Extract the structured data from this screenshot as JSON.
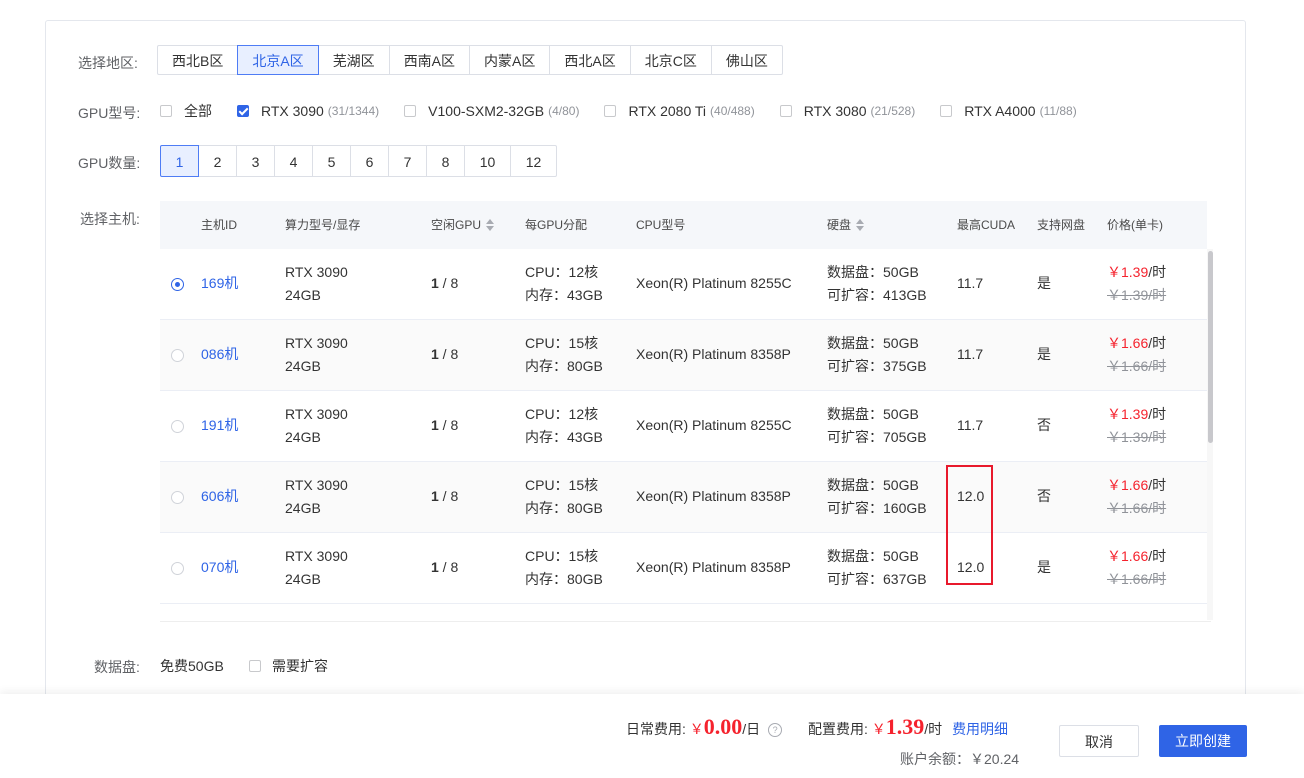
{
  "form": {
    "region_label": "选择地区:",
    "gpu_model_label": "GPU型号:",
    "gpu_count_label": "GPU数量:",
    "host_label": "选择主机:",
    "data_disk_label": "数据盘:"
  },
  "regions": [
    "西北B区",
    "北京A区",
    "芜湖区",
    "西南A区",
    "内蒙A区",
    "西北A区",
    "北京C区",
    "佛山区"
  ],
  "region_selected": "北京A区",
  "gpu_models": [
    {
      "name": "全部",
      "count": "",
      "checked": false
    },
    {
      "name": "RTX 3090",
      "count": "(31/1344)",
      "checked": true
    },
    {
      "name": "V100-SXM2-32GB",
      "count": "(4/80)",
      "checked": false
    },
    {
      "name": "RTX 2080 Ti",
      "count": "(40/488)",
      "checked": false
    },
    {
      "name": "RTX 3080",
      "count": "(21/528)",
      "checked": false
    },
    {
      "name": "RTX A4000",
      "count": "(11/88)",
      "checked": false
    }
  ],
  "gpu_counts": [
    "1",
    "2",
    "3",
    "4",
    "5",
    "6",
    "7",
    "8",
    "10",
    "12"
  ],
  "gpu_count_selected": "1",
  "table": {
    "headers": {
      "host_id": "主机ID",
      "gpu_model": "算力型号/显存",
      "free_gpu": "空闲GPU",
      "per_gpu": "每GPU分配",
      "cpu": "CPU型号",
      "disk": "硬盘",
      "cuda": "最高CUDA",
      "netdisk": "支持网盘",
      "price": "价格(单卡)"
    },
    "rows": [
      {
        "selected": true,
        "id": "169机",
        "gpu": "RTX 3090",
        "vram": "24GB",
        "free": "1",
        "total": " / 8",
        "cpu_cores": "CPU：12核",
        "mem": "内存：43GB",
        "cpu_model": "Xeon(R) Platinum 8255C",
        "disk": "数据盘：50GB",
        "expand": "可扩容：413GB",
        "cuda": "11.7",
        "netdisk": "是",
        "price": "￥1.39",
        "unit": "/时",
        "old_price": "￥1.39/时"
      },
      {
        "selected": false,
        "id": "086机",
        "gpu": "RTX 3090",
        "vram": "24GB",
        "free": "1",
        "total": " / 8",
        "cpu_cores": "CPU：15核",
        "mem": "内存：80GB",
        "cpu_model": "Xeon(R) Platinum 8358P",
        "disk": "数据盘：50GB",
        "expand": "可扩容：375GB",
        "cuda": "11.7",
        "netdisk": "是",
        "price": "￥1.66",
        "unit": "/时",
        "old_price": "￥1.66/时"
      },
      {
        "selected": false,
        "id": "191机",
        "gpu": "RTX 3090",
        "vram": "24GB",
        "free": "1",
        "total": " / 8",
        "cpu_cores": "CPU：12核",
        "mem": "内存：43GB",
        "cpu_model": "Xeon(R) Platinum 8255C",
        "disk": "数据盘：50GB",
        "expand": "可扩容：705GB",
        "cuda": "11.7",
        "netdisk": "否",
        "price": "￥1.39",
        "unit": "/时",
        "old_price": "￥1.39/时"
      },
      {
        "selected": false,
        "id": "606机",
        "gpu": "RTX 3090",
        "vram": "24GB",
        "free": "1",
        "total": " / 8",
        "cpu_cores": "CPU：15核",
        "mem": "内存：80GB",
        "cpu_model": "Xeon(R) Platinum 8358P",
        "disk": "数据盘：50GB",
        "expand": "可扩容：160GB",
        "cuda": "12.0",
        "netdisk": "否",
        "price": "￥1.66",
        "unit": "/时",
        "old_price": "￥1.66/时"
      },
      {
        "selected": false,
        "id": "070机",
        "gpu": "RTX 3090",
        "vram": "24GB",
        "free": "1",
        "total": " / 8",
        "cpu_cores": "CPU：15核",
        "mem": "内存：80GB",
        "cpu_model": "Xeon(R) Platinum 8358P",
        "disk": "数据盘：50GB",
        "expand": "可扩容：637GB",
        "cuda": "12.0",
        "netdisk": "是",
        "price": "￥1.66",
        "unit": "/时",
        "old_price": "￥1.66/时"
      }
    ]
  },
  "data_disk": {
    "free": "免费50GB",
    "expand_option": "需要扩容"
  },
  "footer": {
    "daily_label": "日常费用:",
    "daily_yen": "￥",
    "daily_value": "0.00",
    "daily_unit": "/日",
    "help_glyph": "?",
    "config_label": "配置费用:",
    "config_yen": "￥",
    "config_value": "1.39",
    "config_unit": "/时",
    "detail_link": "费用明细",
    "balance": "账户余额：￥20.24",
    "cancel": "取消",
    "create": "立即创建"
  },
  "colors": {
    "accent": "#2f64e6",
    "price": "#f5222d",
    "highlight": "#e8192c"
  }
}
